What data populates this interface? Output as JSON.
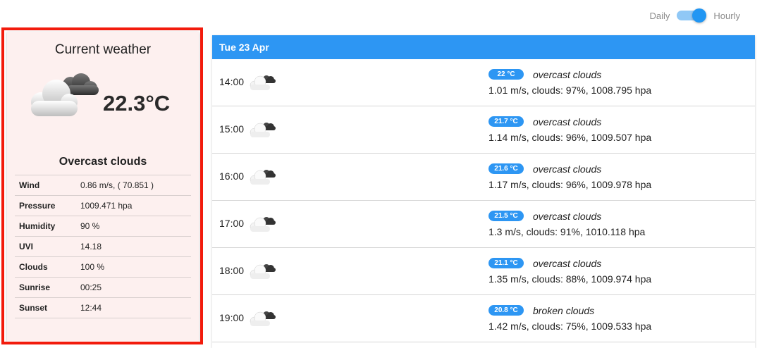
{
  "toggle": {
    "left_label": "Daily",
    "right_label": "Hourly",
    "selected": "Hourly"
  },
  "current": {
    "title": "Current weather",
    "icon": "overcast-clouds-icon",
    "temperature": "22.3°C",
    "description": "Overcast clouds",
    "rows": [
      {
        "label": "Wind",
        "value": "0.86 m/s, ( 70.851 )"
      },
      {
        "label": "Pressure",
        "value": "1009.471 hpa"
      },
      {
        "label": "Humidity",
        "value": "90 %"
      },
      {
        "label": "UVI",
        "value": "14.18"
      },
      {
        "label": "Clouds",
        "value": "100 %"
      },
      {
        "label": "Sunrise",
        "value": "00:25"
      },
      {
        "label": "Sunset",
        "value": "12:44"
      }
    ]
  },
  "hourly": {
    "day": "Tue 23 Apr",
    "rows": [
      {
        "time": "14:00",
        "icon": "overcast-clouds-icon",
        "temp": "22 °C",
        "description": "overcast clouds",
        "details": "1.01 m/s, clouds: 97%, 1008.795 hpa"
      },
      {
        "time": "15:00",
        "icon": "overcast-clouds-icon",
        "temp": "21.7 °C",
        "description": "overcast clouds",
        "details": "1.14 m/s, clouds: 96%, 1009.507 hpa"
      },
      {
        "time": "16:00",
        "icon": "overcast-clouds-icon",
        "temp": "21.6 °C",
        "description": "overcast clouds",
        "details": "1.17 m/s, clouds: 96%, 1009.978 hpa"
      },
      {
        "time": "17:00",
        "icon": "overcast-clouds-icon",
        "temp": "21.5 °C",
        "description": "overcast clouds",
        "details": "1.3 m/s, clouds: 91%, 1010.118 hpa"
      },
      {
        "time": "18:00",
        "icon": "overcast-clouds-icon",
        "temp": "21.1 °C",
        "description": "overcast clouds",
        "details": "1.35 m/s, clouds: 88%, 1009.974 hpa"
      },
      {
        "time": "19:00",
        "icon": "broken-clouds-icon",
        "temp": "20.8 °C",
        "description": "broken clouds",
        "details": "1.42 m/s, clouds: 75%, 1009.533 hpa"
      }
    ]
  },
  "colors": {
    "accent": "#2d96f3",
    "highlight": "#f21b0c",
    "card_bg": "#fdf0ef"
  }
}
